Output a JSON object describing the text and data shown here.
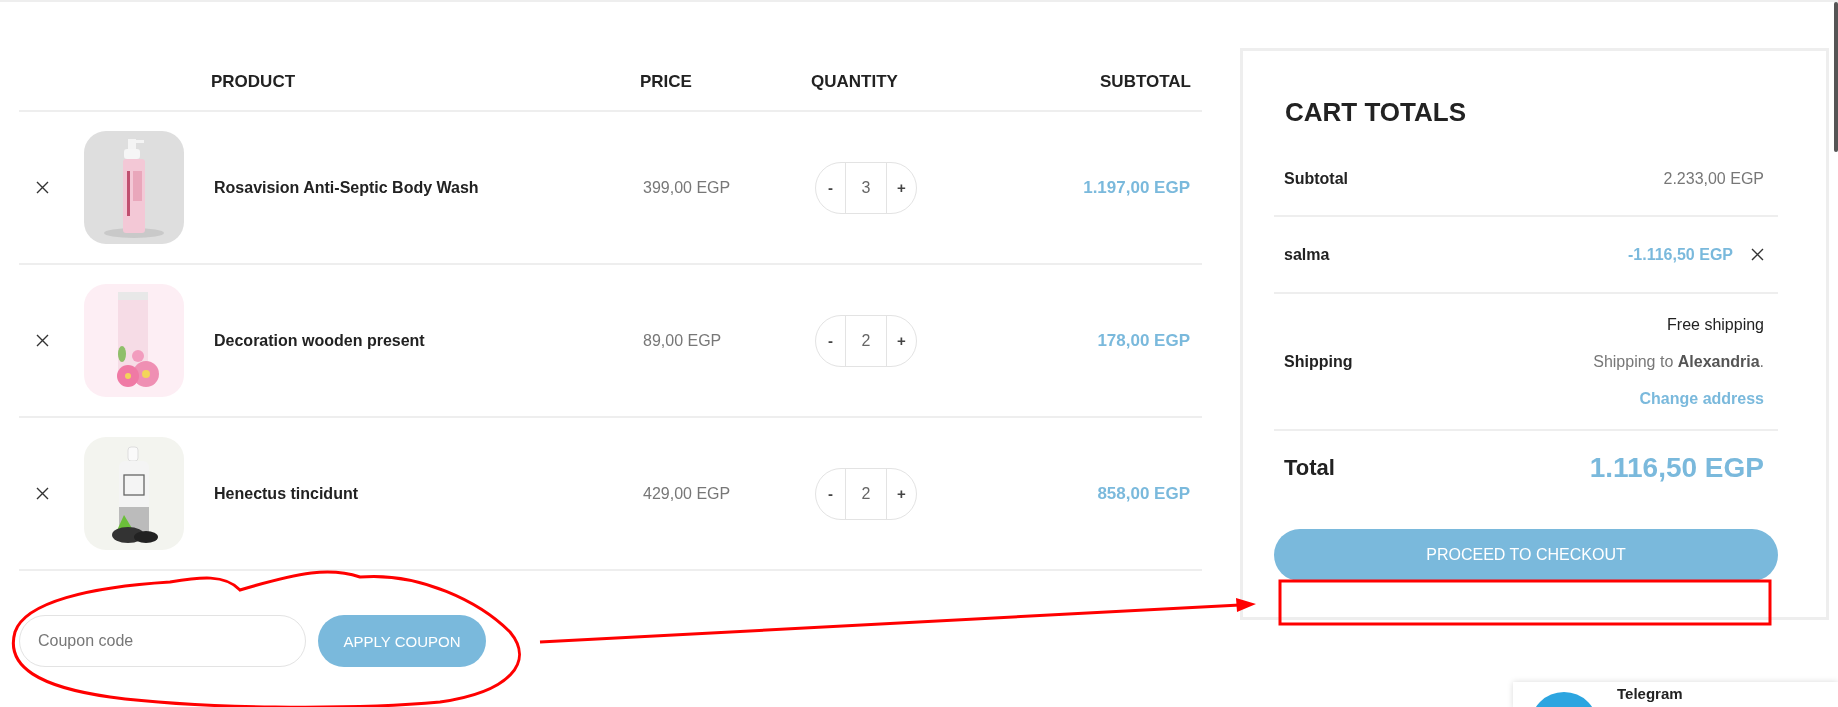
{
  "cart_table": {
    "columns": [
      "PRODUCT",
      "PRICE",
      "QUANTITY",
      "SUBTOTAL"
    ],
    "rows": [
      {
        "name": "Rosavision Anti-Septic Body Wash",
        "price": "399,00 EGP",
        "decrease": "-",
        "quantity": "3",
        "increase": "+",
        "subtotal": "1.197,00 EGP"
      },
      {
        "name": "Decoration wooden present",
        "price": "89,00 EGP",
        "decrease": "-",
        "quantity": "2",
        "increase": "+",
        "subtotal": "178,00 EGP"
      },
      {
        "name": "Henectus tincidunt",
        "price": "429,00 EGP",
        "decrease": "-",
        "quantity": "2",
        "increase": "+",
        "subtotal": "858,00 EGP"
      }
    ]
  },
  "coupon": {
    "placeholder": "Coupon code",
    "button": "APPLY COUPON"
  },
  "cart_totals": {
    "title": "CART TOTALS",
    "subtotal": {
      "label": "Subtotal",
      "value": "2.233,00 EGP"
    },
    "discount": {
      "label": "salma",
      "value": "-1.116,50 EGP"
    },
    "shipping": {
      "label": "Shipping",
      "method": "Free shipping",
      "destination": "Shipping to **Alexandria**.",
      "link": "Change address"
    },
    "total": {
      "label": "Total",
      "value": "1.116,50 EGP"
    },
    "checkout_button": "PROCEED TO CHECKOUT"
  },
  "chat_widget": {
    "label": "Telegram"
  }
}
